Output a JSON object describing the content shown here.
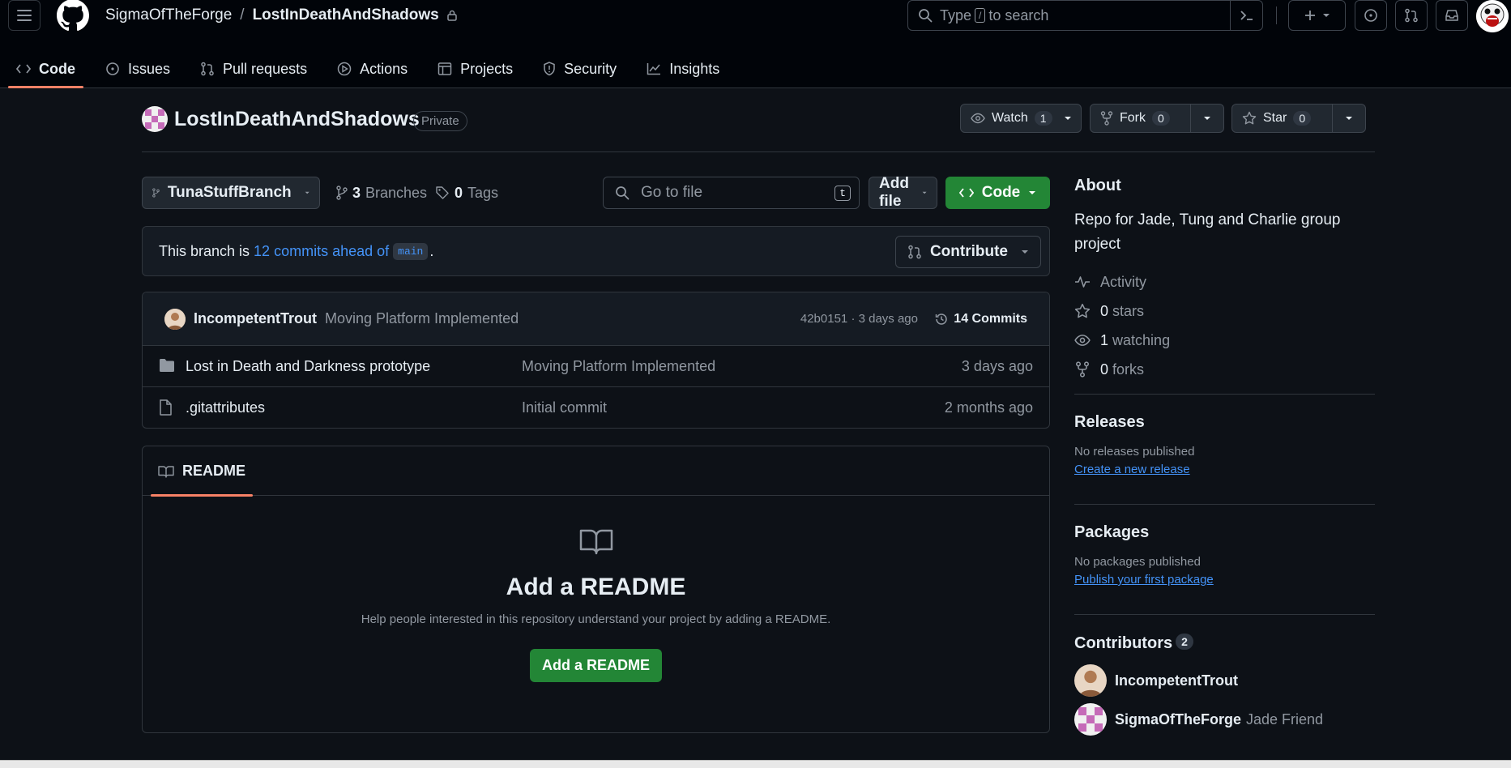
{
  "header": {
    "owner": "SigmaOfTheForge",
    "separator": "/",
    "repo": "LostInDeathAndShadows",
    "search_prefix": "Type",
    "search_key": "/",
    "search_suffix": "to search"
  },
  "nav": {
    "tabs": [
      {
        "label": "Code",
        "icon": "code-icon"
      },
      {
        "label": "Issues",
        "icon": "issue-icon"
      },
      {
        "label": "Pull requests",
        "icon": "pull-request-icon"
      },
      {
        "label": "Actions",
        "icon": "play-icon"
      },
      {
        "label": "Projects",
        "icon": "table-icon"
      },
      {
        "label": "Security",
        "icon": "shield-icon"
      },
      {
        "label": "Insights",
        "icon": "graph-icon"
      }
    ]
  },
  "repo": {
    "name": "LostInDeathAndShadows",
    "visibility": "Private",
    "watch_label": "Watch",
    "watch_count": "1",
    "fork_label": "Fork",
    "fork_count": "0",
    "star_label": "Star",
    "star_count": "0"
  },
  "toolbar": {
    "branch": "TunaStuffBranch",
    "branches_count": "3",
    "branches_label": "Branches",
    "tags_count": "0",
    "tags_label": "Tags",
    "goto_placeholder": "Go to file",
    "goto_key": "t",
    "add_file": "Add file",
    "code": "Code"
  },
  "ahead": {
    "prefix": "This branch is",
    "link": "12 commits ahead of",
    "base": "main",
    "suffix": ".",
    "contribute": "Contribute"
  },
  "latest_commit": {
    "author": "IncompetentTrout",
    "message": "Moving Platform Implemented",
    "hash_time": "42b0151 · 3 days ago",
    "commits": "14 Commits"
  },
  "files": [
    {
      "type": "folder",
      "name": "Lost in Death and Darkness prototype",
      "message": "Moving Platform Implemented",
      "age": "3 days ago"
    },
    {
      "type": "file",
      "name": ".gitattributes",
      "message": "Initial commit",
      "age": "2 months ago"
    }
  ],
  "readme": {
    "tab": "README",
    "title": "Add a README",
    "description": "Help people interested in this repository understand your project by adding a README.",
    "button": "Add a README"
  },
  "about": {
    "title": "About",
    "description": "Repo for Jade, Tung and Charlie group project",
    "activity": "Activity",
    "stars_count": "0",
    "stars_label": "stars",
    "watching_count": "1",
    "watching_label": "watching",
    "forks_count": "0",
    "forks_label": "forks"
  },
  "releases": {
    "title": "Releases",
    "text": "No releases published",
    "link": "Create a new release"
  },
  "packages": {
    "title": "Packages",
    "text": "No packages published",
    "link": "Publish your first package"
  },
  "contributors": {
    "title": "Contributors",
    "count": "2",
    "list": [
      {
        "name": "IncompetentTrout",
        "role": ""
      },
      {
        "name": "SigmaOfTheForge",
        "role": "Jade Friend"
      }
    ]
  },
  "colors": {
    "accent": "#238636",
    "link": "#4493f8",
    "tab_underline": "#f78166",
    "bg": "#0d1117"
  }
}
